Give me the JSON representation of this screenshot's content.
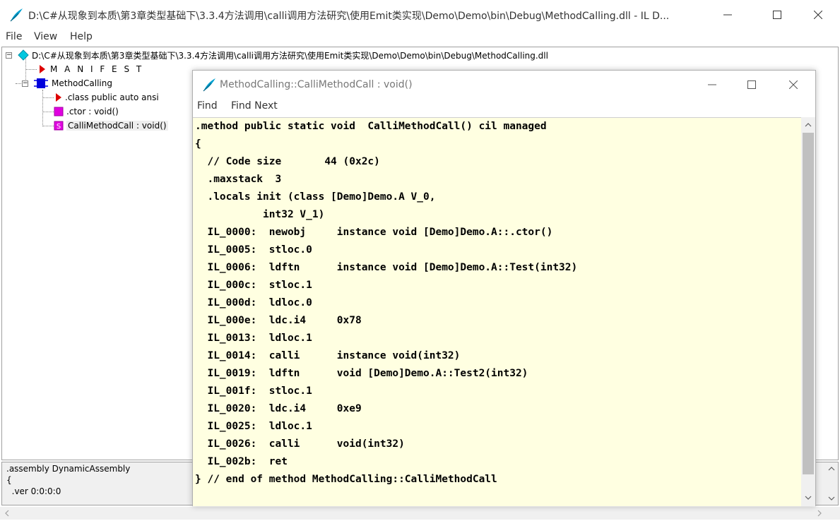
{
  "main_window": {
    "title": "D:\\C#从现象到本质\\第3章类型基础下\\3.3.4方法调用\\calli调用方法研究\\使用Emit类实现\\Demo\\Demo\\bin\\Debug\\MethodCalling.dll - IL D...",
    "menu": [
      "File",
      "View",
      "Help"
    ]
  },
  "tree": {
    "root": "D:\\C#从现象到本质\\第3章类型基础下\\3.3.4方法调用\\calli调用方法研究\\使用Emit类实现\\Demo\\Demo\\bin\\Debug\\MethodCalling.dll",
    "manifest": "M A N I F E S T",
    "class_name": "MethodCalling",
    "class_children": [
      ".class public auto ansi",
      ".ctor : void()",
      "CalliMethodCall : void()"
    ]
  },
  "bottom_pane": {
    "lines": [
      ".assembly DynamicAssembly",
      "{",
      "  .ver 0:0:0:0"
    ]
  },
  "il_window": {
    "title": "MethodCalling::CalliMethodCall : void()",
    "menu": [
      "Find",
      "Find Next"
    ],
    "code_lines": [
      ".method public static void  CalliMethodCall() cil managed",
      "{",
      "  // Code size       44 (0x2c)",
      "  .maxstack  3",
      "  .locals init (class [Demo]Demo.A V_0,",
      "           int32 V_1)",
      "  IL_0000:  newobj     instance void [Demo]Demo.A::.ctor()",
      "  IL_0005:  stloc.0",
      "  IL_0006:  ldftn      instance void [Demo]Demo.A::Test(int32)",
      "  IL_000c:  stloc.1",
      "  IL_000d:  ldloc.0",
      "  IL_000e:  ldc.i4     0x78",
      "  IL_0013:  ldloc.1",
      "  IL_0014:  calli      instance void(int32)",
      "  IL_0019:  ldftn      void [Demo]Demo.A::Test2(int32)",
      "  IL_001f:  stloc.1",
      "  IL_0020:  ldc.i4     0xe9",
      "  IL_0025:  ldloc.1",
      "  IL_0026:  calli      void(int32)",
      "  IL_002b:  ret",
      "} // end of method MethodCalling::CalliMethodCall"
    ]
  },
  "colors": {
    "code_background": "#ffffe1",
    "manifest_triangle": "#dd0000",
    "class_icon": "#0000dd",
    "method_icon": "#e000e0",
    "assembly_icon": "#00c8e0"
  },
  "icons": {
    "app": "feather-icon",
    "assembly": "diamond-icon",
    "manifest": "triangle-icon",
    "class": "class-icon",
    "method": "method-icon",
    "static_method": "static-method-icon"
  }
}
